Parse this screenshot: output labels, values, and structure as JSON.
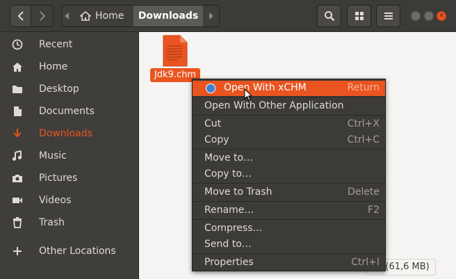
{
  "header": {
    "breadcrumb_home": "Home",
    "breadcrumb_current": "Downloads",
    "icons": [
      "back-arrow-icon",
      "forward-arrow-icon",
      "home-icon",
      "search-icon",
      "view-toggle-icon",
      "hamburger-menu-icon"
    ]
  },
  "sidebar": {
    "items": [
      {
        "label": "Recent",
        "icon": "clock-icon"
      },
      {
        "label": "Home",
        "icon": "home-icon"
      },
      {
        "label": "Desktop",
        "icon": "folder-icon"
      },
      {
        "label": "Documents",
        "icon": "document-icon"
      },
      {
        "label": "Downloads",
        "icon": "download-icon",
        "active": true
      },
      {
        "label": "Music",
        "icon": "music-icon"
      },
      {
        "label": "Pictures",
        "icon": "camera-icon"
      },
      {
        "label": "Videos",
        "icon": "video-icon"
      },
      {
        "label": "Trash",
        "icon": "trash-icon"
      },
      {
        "label": "Other Locations",
        "icon": "plus-icon"
      }
    ]
  },
  "content": {
    "file_name": "Jdk9.chm",
    "status_text": "ed (61,6 MB)"
  },
  "context_menu": {
    "items": [
      {
        "label": "Open With xCHM",
        "shortcut": "Return",
        "highlighted": true
      },
      {
        "label": "Open With Other Application",
        "shortcut": ""
      },
      {
        "label": "Cut",
        "shortcut": "Ctrl+X"
      },
      {
        "label": "Copy",
        "shortcut": "Ctrl+C"
      },
      {
        "label": "Move to…",
        "shortcut": ""
      },
      {
        "label": "Copy to…",
        "shortcut": ""
      },
      {
        "label": "Move to Trash",
        "shortcut": "Delete"
      },
      {
        "label": "Rename…",
        "shortcut": "F2"
      },
      {
        "label": "Compress…",
        "shortcut": ""
      },
      {
        "label": "Send to…",
        "shortcut": ""
      },
      {
        "label": "Properties",
        "shortcut": "Ctrl+I"
      }
    ]
  },
  "colors": {
    "accent": "#e95420",
    "header_bg": "#3c3b37",
    "sidebar_bg": "#3f3e3a",
    "content_bg": "#f5f4f2"
  }
}
